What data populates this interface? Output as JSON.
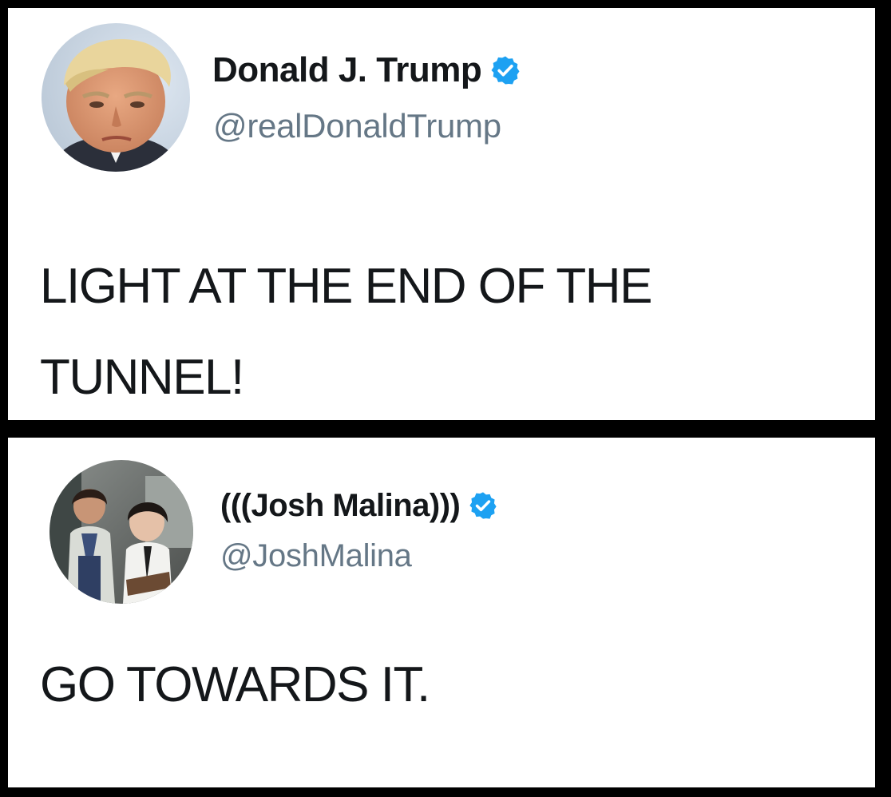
{
  "colors": {
    "background": "#000000",
    "card": "#ffffff",
    "name_text": "#14171a",
    "handle_text": "#657786",
    "verified_blue": "#1da1f2"
  },
  "tweets": [
    {
      "display_name": "Donald J. Trump",
      "handle": "@realDonaldTrump",
      "verified": true,
      "verified_icon": "verified-badge-icon",
      "text": "LIGHT AT THE END OF THE TUNNEL!"
    },
    {
      "display_name": "(((Josh Malina)))",
      "handle": "@JoshMalina",
      "verified": true,
      "verified_icon": "verified-badge-icon",
      "text": "GO TOWARDS IT."
    }
  ]
}
